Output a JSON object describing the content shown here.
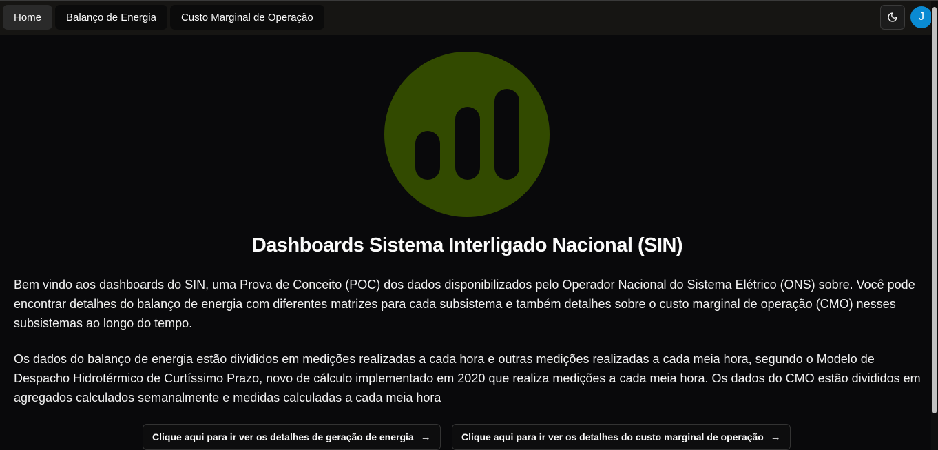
{
  "nav": {
    "items": [
      {
        "label": "Home",
        "active": true
      },
      {
        "label": "Balanço de Energia",
        "active": false
      },
      {
        "label": "Custo Marginal de Operação",
        "active": false
      }
    ]
  },
  "header": {
    "theme_icon": "moon-icon",
    "avatar_initial": "J",
    "avatar_color": "#0a8ad2"
  },
  "logo": {
    "icon": "bar-chart-icon",
    "circle_color": "#324a00"
  },
  "main": {
    "title": "Dashboards Sistema Interligado Nacional (SIN)",
    "paragraph_1": "Bem vindo aos dashboards do SIN, uma Prova de Conceito (POC) dos dados disponibilizados pelo Operador Nacional do Sistema Elétrico (ONS) sobre. Você pode encontrar detalhes do balanço de energia com diferentes matrizes para cada subsistema e também detalhes sobre o custo marginal de operação (CMO) nesses subsistemas ao longo do tempo.",
    "paragraph_2": "Os dados do balanço de energia estão divididos em medições realizadas a cada hora e outras medições realizadas a cada meia hora, segundo o Modelo de Despacho Hidrotérmico de Curtíssimo Prazo, novo de cálculo implementado em 2020 que realiza medições a cada meia hora. Os dados do CMO estão divididos em agregados calculados semanalmente e medidas calculadas a cada meia hora"
  },
  "cta": {
    "generation_label": "Clique aqui para ir ver os detalhes de geração de energia",
    "cmo_label": "Clique aqui para ir ver os detalhes do custo marginal de operação",
    "arrow_icon": "arrow-right-icon"
  }
}
